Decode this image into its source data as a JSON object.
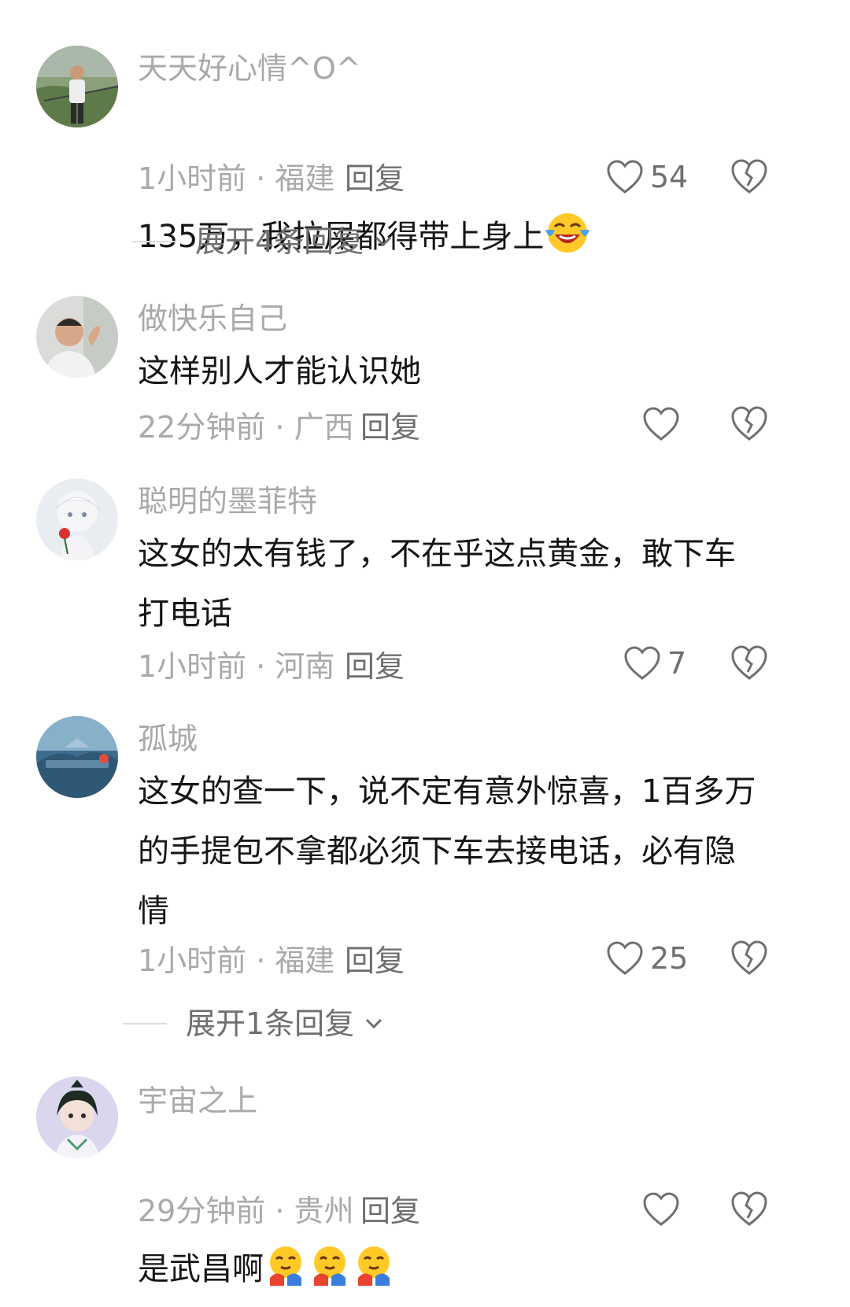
{
  "comments": [
    {
      "username": "天天好心情^O^",
      "text": "135万，我拉屎都得带上身上",
      "emojis": [
        "laughing-crying-emoji"
      ],
      "time_location": "1小时前 · 福建",
      "reply_label": "回复",
      "likes": "54",
      "expand_label": "展开4条回复"
    },
    {
      "username": "做快乐自己",
      "text": "这样别人才能认识她",
      "emojis": [],
      "time_location": "22分钟前 · 广西",
      "reply_label": "回复",
      "likes": ""
    },
    {
      "username": "聪明的墨菲特",
      "text": "这女的太有钱了，不在乎这点黄金，敢下车\n打电话",
      "emojis": [],
      "time_location": "1小时前 · 河南",
      "reply_label": "回复",
      "likes": "7"
    },
    {
      "username": "孤城",
      "text": "这女的查一下，说不定有意外惊喜，1百多万\n的手提包不拿都必须下车去接电话，必有隐\n情",
      "emojis": [],
      "time_location": "1小时前 · 福建",
      "reply_label": "回复",
      "likes": "25",
      "expand_label": "展开1条回复"
    },
    {
      "username": "宇宙之上",
      "text": "是武昌啊",
      "emojis": [
        "hugging-face-emoji",
        "hugging-face-emoji",
        "hugging-face-emoji"
      ],
      "time_location": "29分钟前 · 贵州",
      "reply_label": "回复",
      "likes": ""
    }
  ],
  "colors": {
    "secondary_text": "#a9a9a9",
    "primary_text": "#161616",
    "action_text": "#6f6f6f"
  }
}
